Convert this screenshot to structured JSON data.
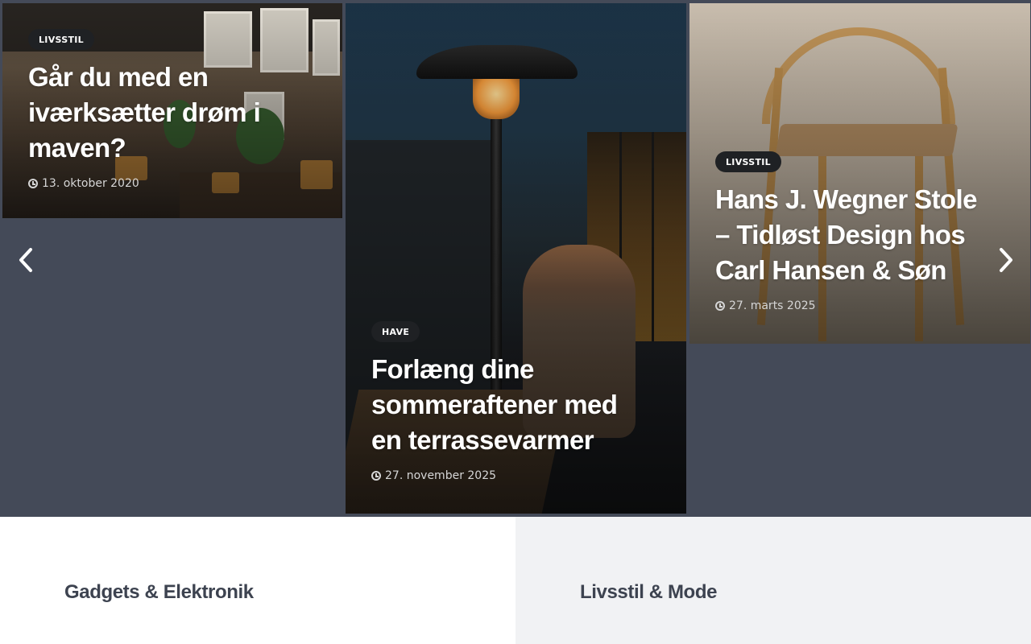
{
  "slider": {
    "cards": [
      {
        "category": "LIVSSTIL",
        "title": "Går du med en iværksætter drøm i maven?",
        "date": "13. oktober 2020"
      },
      {
        "category": "HAVE",
        "title": "Forlæng dine sommeraftener med en terrassevarmer",
        "date": "27. november 2025"
      },
      {
        "category": "LIVSSTIL",
        "title": "Hans J. Wegner Stole – Tidløst Design hos Carl Hansen & Søn",
        "date": "27. marts 2025"
      }
    ],
    "prev_icon": "chevron-left-icon",
    "next_icon": "chevron-right-icon"
  },
  "sections": {
    "left_title": "Gadgets & Elektronik",
    "right_title": "Livsstil & Mode"
  },
  "colors": {
    "slider_bg": "#444a58",
    "tag_bg": "#1f2124",
    "section_title": "#3d4350",
    "section_right_bg": "#f1f2f4"
  }
}
